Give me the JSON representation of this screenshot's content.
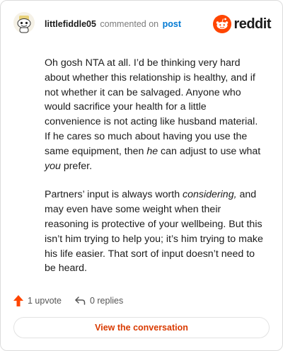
{
  "header": {
    "username": "littlefiddle05",
    "action_text": "commented on",
    "post_link": "post",
    "brand_name": "reddit",
    "avatar_icon": "snoo-avatar-icon",
    "brand_icon": "reddit-logo-icon"
  },
  "comment": {
    "p1_a": "Oh gosh NTA at all. I’d be thinking very hard about whether this relationship is healthy, and if not whether it can be salvaged. Anyone who would sacrifice your health for a little convenience is not acting like husband material. If he cares so much about having you use the same equipment, then ",
    "p1_em1": "he",
    "p1_b": " can adjust to use what ",
    "p1_em2": "you",
    "p1_c": " prefer.",
    "p2_a": "Partners’ input is always worth ",
    "p2_em": "considering,",
    "p2_b": " and may even have some weight when their reasoning is protective of your wellbeing. But this isn’t him trying to help you; it’s him trying to make his life easier. That sort of input doesn’t need to be heard."
  },
  "actions": {
    "upvote_label": "1 upvote",
    "replies_label": "0 replies",
    "upvote_icon": "upvote-arrow-icon",
    "reply_icon": "reply-arrow-icon"
  },
  "footer": {
    "view_button": "View the conversation"
  },
  "colors": {
    "reddit_orange": "#ff4500",
    "link_blue": "#0079d3",
    "button_text": "#d93a00"
  }
}
